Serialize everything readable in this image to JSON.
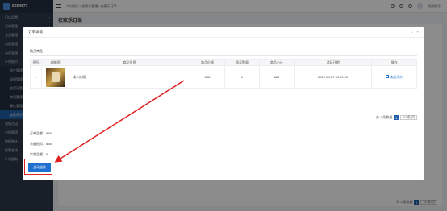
{
  "app": {
    "account": "5654677"
  },
  "sidebar": {
    "items": [
      {
        "label": "门店设置",
        "type": "item"
      },
      {
        "label": "订单管理",
        "type": "item"
      },
      {
        "label": "会员管理",
        "type": "item"
      },
      {
        "label": "内容管理",
        "type": "item"
      },
      {
        "label": "商家管理",
        "type": "item"
      },
      {
        "label": "乡村振兴",
        "type": "item"
      },
      {
        "label": "农庄管理",
        "type": "sub"
      },
      {
        "label": "采摘管理",
        "type": "sub"
      },
      {
        "label": "农家乐管理",
        "type": "sub"
      },
      {
        "label": "房间管理",
        "type": "sub"
      },
      {
        "label": "餐饮管理",
        "type": "sub"
      },
      {
        "label": "农家乐订单",
        "type": "active"
      },
      {
        "label": "营销活动",
        "type": "item"
      },
      {
        "label": "分销管理",
        "type": "item"
      },
      {
        "label": "数据统计",
        "type": "item"
      },
      {
        "label": "智慧农场",
        "type": "item"
      },
      {
        "label": "乡村服务",
        "type": "item"
      }
    ]
  },
  "header": {
    "breadcrumb": "乡村振兴 / 农家乐管理 / 农家乐订单",
    "user": "测试账号"
  },
  "page": {
    "title": "农家乐订单"
  },
  "bg_pager": {
    "total": "共 1 条数据",
    "page": "1",
    "per_page": "10 条/页"
  },
  "modal": {
    "title": "订单详情",
    "section": "购买商品",
    "columns": [
      "序号",
      "缩略图",
      "商品信息",
      "商品价格",
      "购买数量",
      "商品小计",
      "游玩日期",
      "操作"
    ],
    "rows": [
      {
        "index": "1",
        "name": "成人价格",
        "price": "888",
        "qty": "1",
        "subtotal": "888",
        "date": "2022-09-27 00:00:00",
        "action": "商品评价"
      }
    ],
    "pager": {
      "total": "共 1 条数据",
      "page": "1",
      "per_page": "10 条/页"
    },
    "totals": {
      "order_total": "订单总额：888",
      "paid": "余额抵扣：888",
      "received": "实收总额：0"
    },
    "confirm_label": "主动退款"
  }
}
